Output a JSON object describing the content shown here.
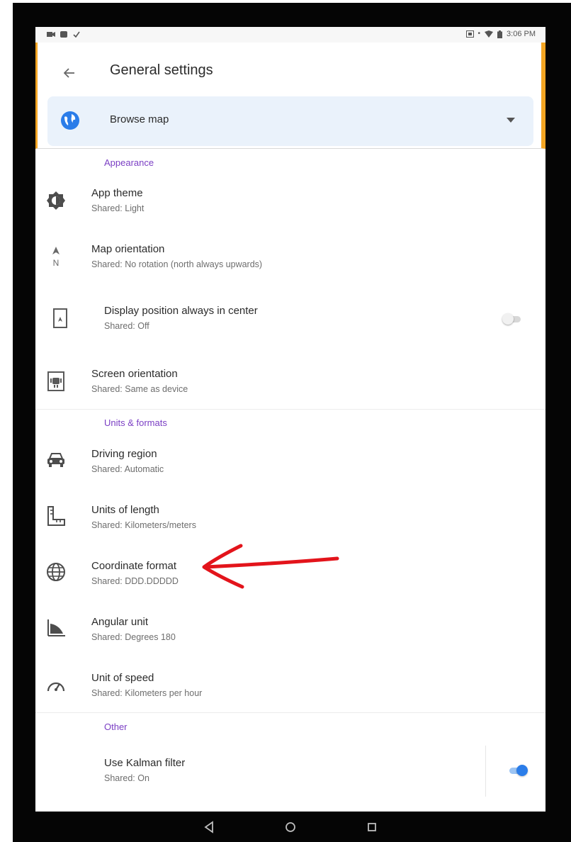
{
  "status_bar": {
    "time": "3:06 PM"
  },
  "header": {
    "title": "General settings",
    "profile": {
      "label": "Browse map"
    }
  },
  "sections": {
    "appearance": {
      "header": "Appearance",
      "items": [
        {
          "title": "App theme",
          "subtitle": "Shared: Light",
          "icon": "theme-icon"
        },
        {
          "title": "Map orientation",
          "subtitle": "Shared: No rotation (north always upwards)",
          "icon": "compass-north-icon"
        },
        {
          "title": "Display position always in center",
          "subtitle": "Shared: Off",
          "icon": "center-position-icon",
          "toggle": false
        },
        {
          "title": "Screen orientation",
          "subtitle": "Shared: Same as device",
          "icon": "screen-rotation-icon"
        }
      ]
    },
    "units": {
      "header": "Units & formats",
      "items": [
        {
          "title": "Driving region",
          "subtitle": "Shared: Automatic",
          "icon": "car-icon"
        },
        {
          "title": "Units of length",
          "subtitle": "Shared: Kilometers/meters",
          "icon": "ruler-icon"
        },
        {
          "title": "Coordinate format",
          "subtitle": "Shared: DDD.DDDDD",
          "icon": "globe-grid-icon"
        },
        {
          "title": "Angular unit",
          "subtitle": "Shared: Degrees 180",
          "icon": "angle-icon"
        },
        {
          "title": "Unit of speed",
          "subtitle": "Shared: Kilometers per hour",
          "icon": "speedometer-icon"
        }
      ]
    },
    "other": {
      "header": "Other",
      "items": [
        {
          "title": "Use Kalman filter",
          "subtitle": "Shared: On",
          "toggle": true
        }
      ]
    }
  },
  "colors": {
    "accent": "#2b7de9",
    "section_header": "#7b3fc4",
    "header_border": "#f5a623",
    "annotation_arrow": "#e3141b"
  }
}
